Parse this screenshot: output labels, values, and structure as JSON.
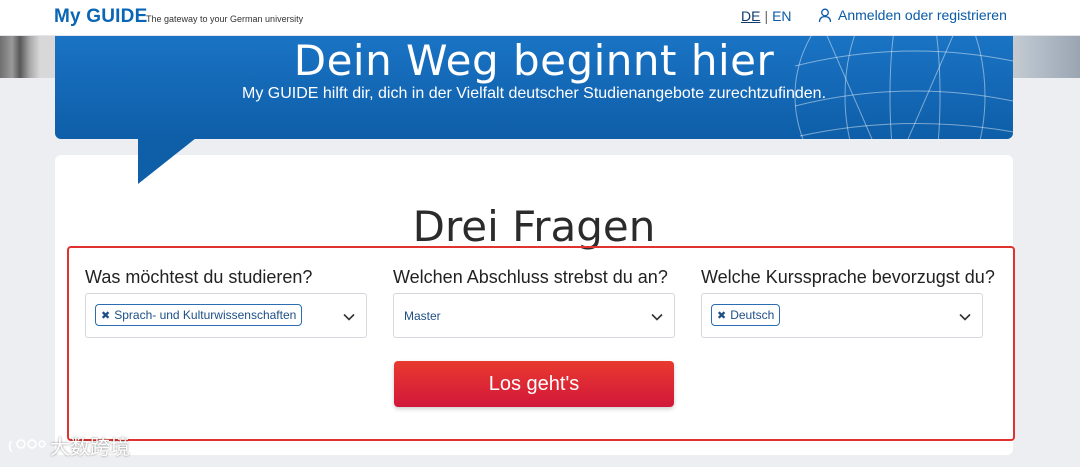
{
  "header": {
    "brand": "My GUIDE",
    "tagline": "The gateway to your German university",
    "lang_de": "DE",
    "lang_sep": "|",
    "lang_en": "EN",
    "login_label": "Anmelden oder registrieren",
    "login_icon": "user-icon"
  },
  "hero": {
    "title": "Dein Weg beginnt hier",
    "subtitle": "My GUIDE hilft dir, dich in der Vielfalt deutscher Studienangebote zurechtzufinden."
  },
  "card": {
    "title": "Drei Fragen",
    "questions": [
      {
        "label": "Was möchtest du studieren?",
        "chip": "Sprach- und Kulturwissenschaften"
      },
      {
        "label": "Welchen Abschluss strebst du an?",
        "value": "Master"
      },
      {
        "label": "Welche Kurssprache bevorzugst du?",
        "chip": "Deutsch"
      }
    ],
    "button_label": "Los geht's"
  },
  "watermark": "大数跨境",
  "colors": {
    "brand_blue": "#0a66b5",
    "hero_blue": "#0e5ea8",
    "button_red": "#e02a35",
    "highlight_red": "#e0322f"
  }
}
